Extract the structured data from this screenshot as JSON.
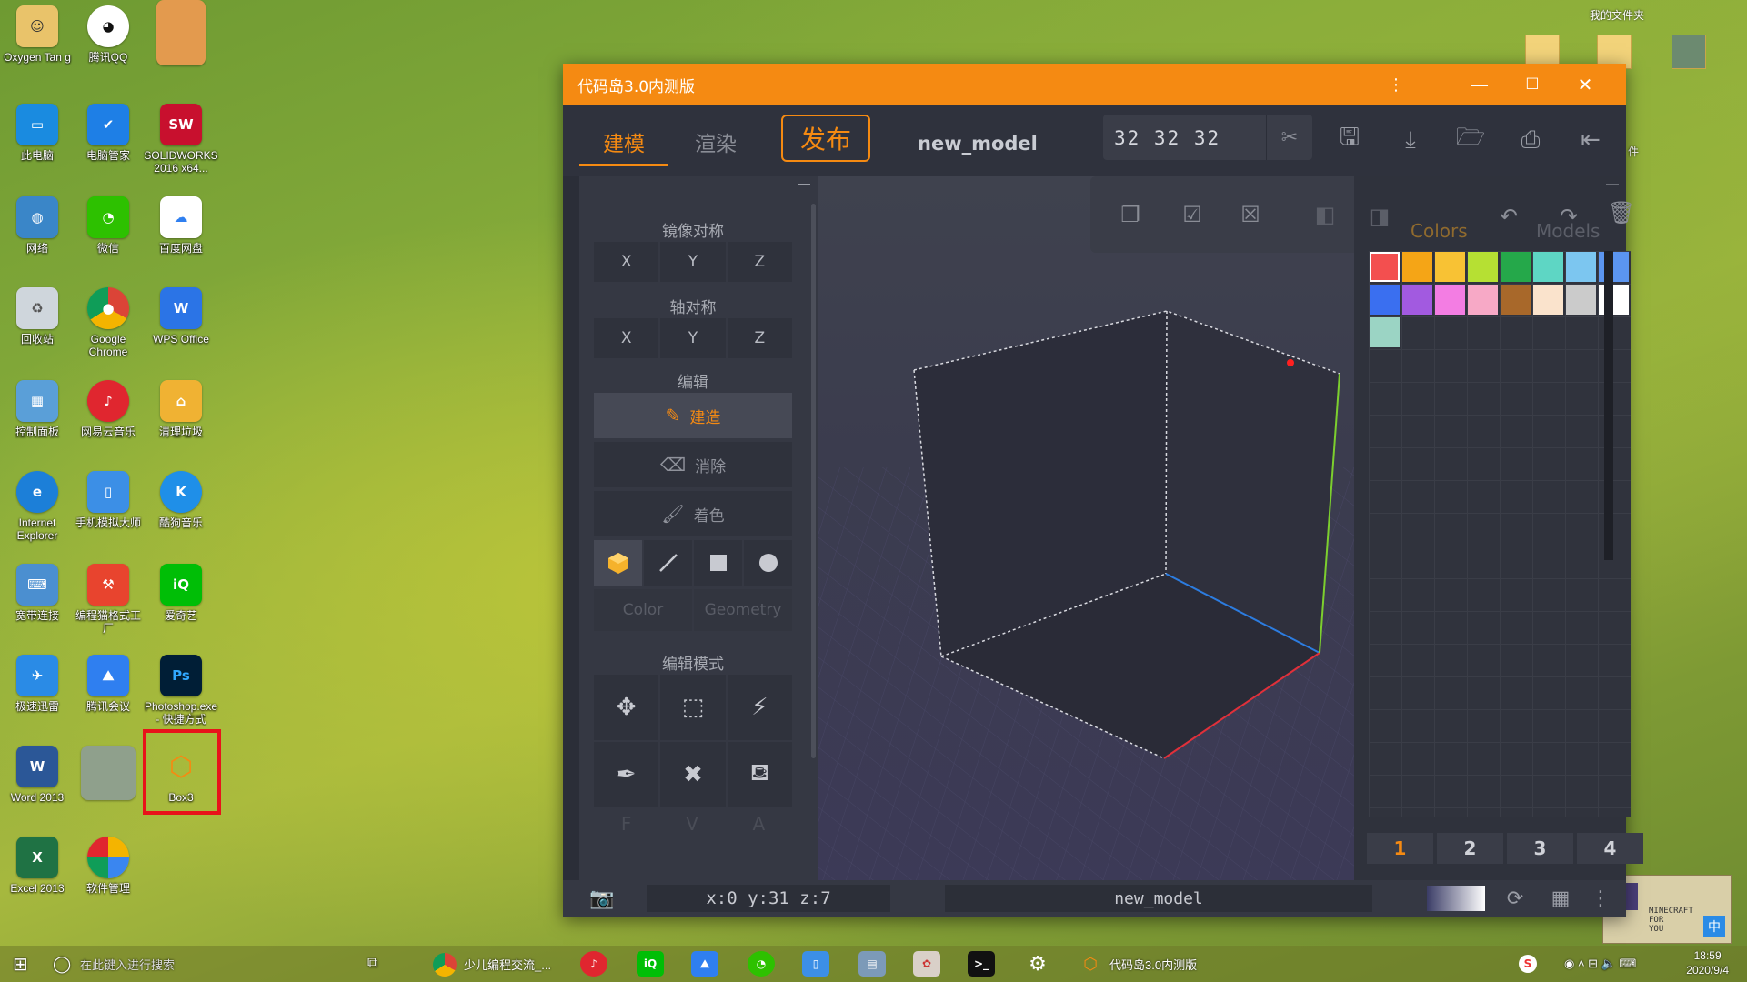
{
  "desktop": {
    "icons": [
      {
        "label": "Oxygen Tan g"
      },
      {
        "label": "腾讯QQ"
      },
      {
        "label": "此电脑"
      },
      {
        "label": "电脑管家"
      },
      {
        "label": "SOLIDWORKS 2016 x64..."
      },
      {
        "label": "网络"
      },
      {
        "label": "微信"
      },
      {
        "label": "百度网盘"
      },
      {
        "label": "回收站"
      },
      {
        "label": "Google Chrome"
      },
      {
        "label": "WPS Office"
      },
      {
        "label": "控制面板"
      },
      {
        "label": "网易云音乐"
      },
      {
        "label": "清理垃圾"
      },
      {
        "label": "Internet Explorer"
      },
      {
        "label": "手机模拟大师"
      },
      {
        "label": "酷狗音乐"
      },
      {
        "label": "宽带连接"
      },
      {
        "label": "编程猫格式工厂"
      },
      {
        "label": "爱奇艺"
      },
      {
        "label": "极速迅雷"
      },
      {
        "label": "腾讯会议"
      },
      {
        "label": "Photoshop.exe - 快捷方式"
      },
      {
        "label": "Word 2013"
      },
      {
        "label": "Box3"
      },
      {
        "label": "Excel 2013"
      },
      {
        "label": "软件管理"
      }
    ],
    "folder_title": "我的文件夹",
    "side_fragment": "件"
  },
  "app": {
    "title": "代码岛3.0内测版",
    "tabs": [
      "建模",
      "渲染",
      "发布"
    ],
    "active_tab": "建模",
    "model_name": "new_model",
    "dimensions": "32 32 32",
    "left_panel": {
      "mirror_title": "镜像对称",
      "axis_title": "轴对称",
      "axes": [
        "X",
        "Y",
        "Z"
      ],
      "edit_title": "编辑",
      "edit_buttons": [
        "建造",
        "消除",
        "着色"
      ],
      "active_edit": "建造",
      "sub_tabs": [
        "Color",
        "Geometry"
      ],
      "mode_title": "编辑模式",
      "footer_letters": [
        "F",
        "V",
        "A"
      ]
    },
    "right_panel": {
      "tabs": [
        "Colors",
        "Models"
      ],
      "active_tab": "Colors",
      "colors": [
        "#f34f4f",
        "#f5a516",
        "#f8c234",
        "#b6e033",
        "#25a84a",
        "#5ed6c4",
        "#7cc6f0",
        "#5b95f0",
        "#3a6ff0",
        "#a25ae0",
        "#f37de3",
        "#f7a9c6",
        "#a8682a",
        "#fae3cc",
        "#cbcbcb",
        "#ffffff",
        "#9bd4c4"
      ],
      "selected_color": "#f34f4f",
      "pages": [
        "1",
        "2",
        "3",
        "4"
      ],
      "active_page": "1"
    },
    "status": {
      "coords": "x:0 y:31 z:7",
      "model_name": "new_model"
    },
    "accent": "#f58a12"
  },
  "taskbar": {
    "search_placeholder": "在此键入进行搜索",
    "items": [
      "少儿编程交流_...",
      "代码岛3.0内测版"
    ],
    "time": "18:59",
    "date": "2020/9/4",
    "ime": "中"
  }
}
